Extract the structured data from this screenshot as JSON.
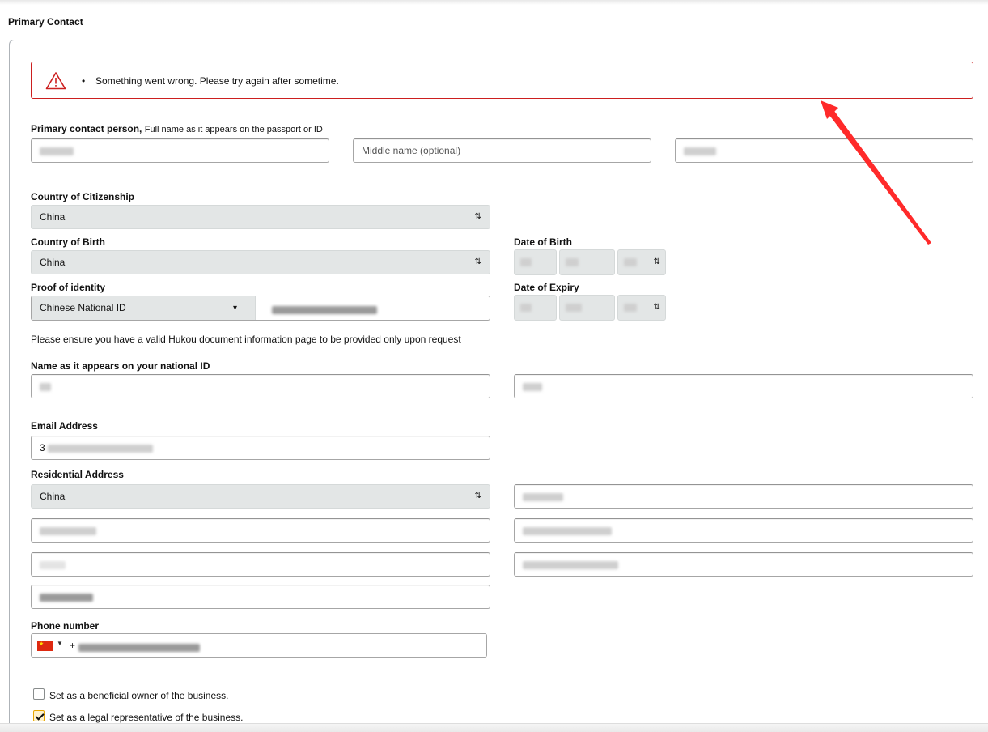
{
  "section": {
    "title": "Primary Contact"
  },
  "alert": {
    "icon": "warning-triangle-icon",
    "bullet": "•",
    "message": "Something went wrong. Please try again after sometime.",
    "border_color": "#cc1f1f"
  },
  "name": {
    "label": "Primary contact person,",
    "hint": "Full name as it appears on the passport or ID",
    "middle_placeholder": "Middle name (optional)"
  },
  "citizenship": {
    "label": "Country of Citizenship",
    "value": "China"
  },
  "birth_country": {
    "label": "Country of Birth",
    "value": "China"
  },
  "dob": {
    "label": "Date of Birth"
  },
  "proof": {
    "label": "Proof of identity",
    "type": "Chinese National ID"
  },
  "expiry": {
    "label": "Date of Expiry"
  },
  "hukou_note": "Please ensure you have a valid Hukou document information page to be provided only upon request",
  "national_id_name": {
    "label": "Name as it appears on your national ID"
  },
  "email": {
    "label": "Email Address",
    "prefix": "3"
  },
  "address": {
    "label": "Residential Address",
    "country": "China"
  },
  "phone": {
    "label": "Phone number",
    "prefix": "+",
    "flag": "china-flag-icon"
  },
  "checkboxes": [
    {
      "label": "Set as a beneficial owner of the business.",
      "checked": false
    },
    {
      "label": "Set as a legal representative of the business.",
      "checked": true
    }
  ],
  "colors": {
    "accent_arrow": "#ff2a2a",
    "checkbox_checked": "#e7a500"
  }
}
